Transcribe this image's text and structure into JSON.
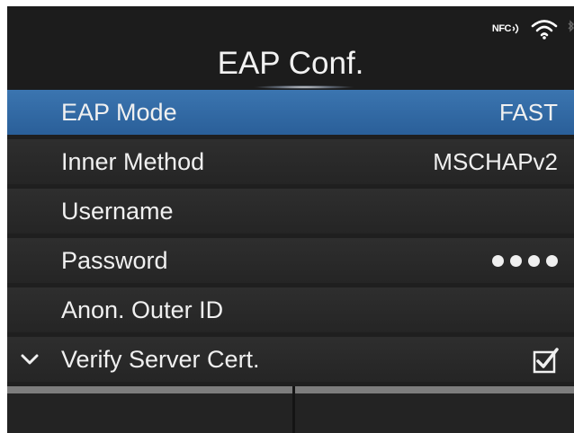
{
  "header": {
    "title": "EAP Conf.",
    "status": {
      "nfc_label": "NFC",
      "icons": [
        "nfc-icon",
        "wifi-icon"
      ]
    }
  },
  "menu": {
    "items": [
      {
        "label": "EAP Mode",
        "value": "FAST",
        "selected": true
      },
      {
        "label": "Inner Method",
        "value": "MSCHAPv2"
      },
      {
        "label": "Username",
        "value": ""
      },
      {
        "label": "Password",
        "value_masked": true
      },
      {
        "label": "Anon. Outer ID",
        "value": ""
      },
      {
        "label": "Verify Server Cert.",
        "checked": true,
        "icon": "chevron-down-icon"
      }
    ]
  },
  "colors": {
    "selected_row": "#2f67a3",
    "row": "#2a2a2a",
    "background": "#1f1f1f"
  }
}
